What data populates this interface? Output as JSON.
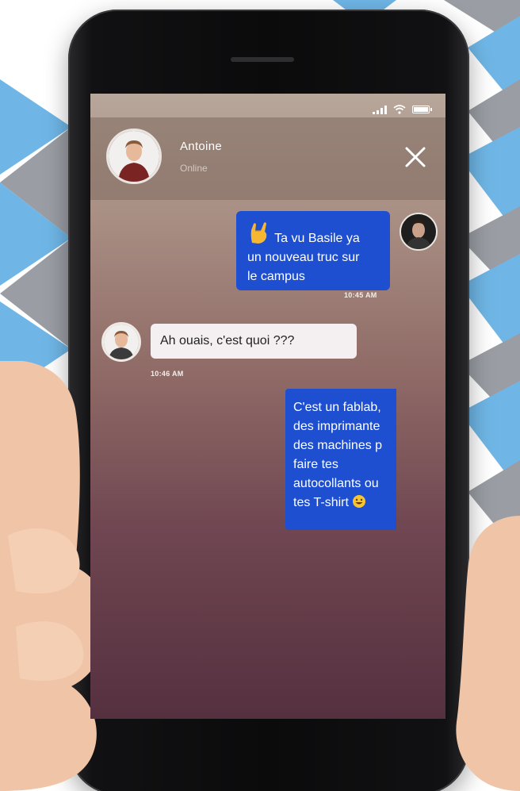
{
  "contact": {
    "name": "Antoine",
    "status": "Online"
  },
  "messages": [
    {
      "direction": "outgoing",
      "emoji": "rock-hand-emoji",
      "lines": [
        "Ta vu Basile ya",
        "un nouveau truc sur",
        "le campus"
      ],
      "time": "10:45 AM"
    },
    {
      "direction": "incoming",
      "lines": [
        "Ah ouais, c'est quoi ???"
      ],
      "time": "10:46 AM"
    },
    {
      "direction": "outgoing",
      "emoji": "grinning-face-emoji",
      "lines": [
        "C'est un fablab,",
        "des imprimante",
        "des machines p",
        "faire tes",
        "autocollants ou",
        "tes T-shirt"
      ],
      "time": ""
    }
  ],
  "colors": {
    "outgoing_bubble": "#1f4fd1",
    "incoming_bubble": "#f4eff1",
    "pattern_blue": "#6fb6e6",
    "pattern_gray": "#9a9ea4"
  }
}
